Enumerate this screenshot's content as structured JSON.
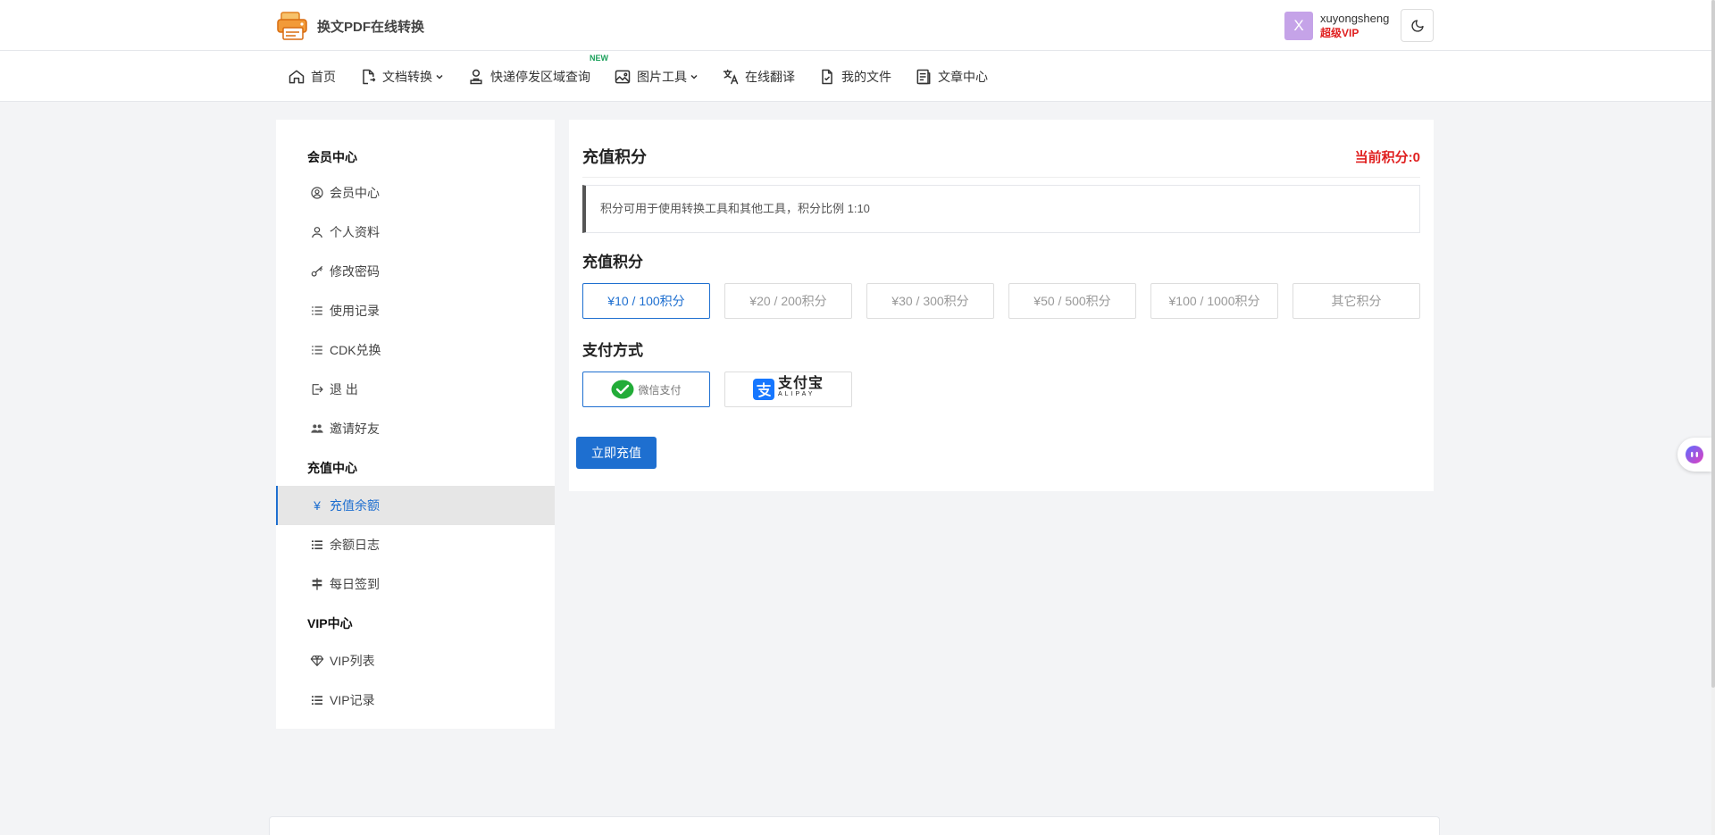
{
  "header": {
    "site_name": "换文PDF在线转换",
    "avatar_letter": "X",
    "username": "xuyongsheng",
    "user_level": "超级VIP"
  },
  "nav": {
    "items": [
      {
        "label": "首页",
        "icon": "home-icon"
      },
      {
        "label": "文档转换",
        "icon": "document-convert-icon",
        "dropdown": true
      },
      {
        "label": "快递停发区域查询",
        "icon": "user-search-icon",
        "badge": "NEW"
      },
      {
        "label": "图片工具",
        "icon": "image-icon",
        "dropdown": true
      },
      {
        "label": "在线翻译",
        "icon": "translate-icon"
      },
      {
        "label": "我的文件",
        "icon": "file-check-icon"
      },
      {
        "label": "文章中心",
        "icon": "article-icon"
      }
    ]
  },
  "sidebar": {
    "groups": [
      {
        "title": "会员中心",
        "items": [
          {
            "label": "会员中心",
            "icon": "user-circle-icon"
          },
          {
            "label": "个人资料",
            "icon": "user-icon"
          },
          {
            "label": "修改密码",
            "icon": "key-icon"
          },
          {
            "label": "使用记录",
            "icon": "list-icon"
          },
          {
            "label": "CDK兑换",
            "icon": "list-icon"
          },
          {
            "label": "退 出",
            "icon": "logout-icon"
          },
          {
            "label": "邀请好友",
            "icon": "users-icon"
          }
        ]
      },
      {
        "title": "充值中心",
        "items": [
          {
            "label": "充值余额",
            "icon": "yen-icon",
            "active": true
          },
          {
            "label": "余额日志",
            "icon": "list-bold-icon"
          },
          {
            "label": "每日签到",
            "icon": "signpost-icon"
          }
        ]
      },
      {
        "title": "VIP中心",
        "items": [
          {
            "label": "VIP列表",
            "icon": "diamond-icon"
          },
          {
            "label": "VIP记录",
            "icon": "list-bold-icon"
          }
        ]
      }
    ]
  },
  "main": {
    "title": "充值积分",
    "current_points": "当前积分:0",
    "notice": "积分可用于使用转换工具和其他工具，积分比例 1:10",
    "amount_section_title": "充值积分",
    "amounts": [
      "¥10 / 100积分",
      "¥20 / 200积分",
      "¥30 / 300积分",
      "¥50 / 500积分",
      "¥100 / 1000积分",
      "其它积分"
    ],
    "selected_amount_index": 0,
    "payment_section_title": "支付方式",
    "payments": {
      "wechat_label": "微信支付",
      "alipay_cn": "支付宝",
      "alipay_en": "ALIPAY"
    },
    "submit_label": "立即充值"
  },
  "colors": {
    "accent": "#1e6fd0",
    "danger": "#e02020",
    "wechat_green": "#22ac38",
    "alipay_blue": "#1677ff"
  }
}
